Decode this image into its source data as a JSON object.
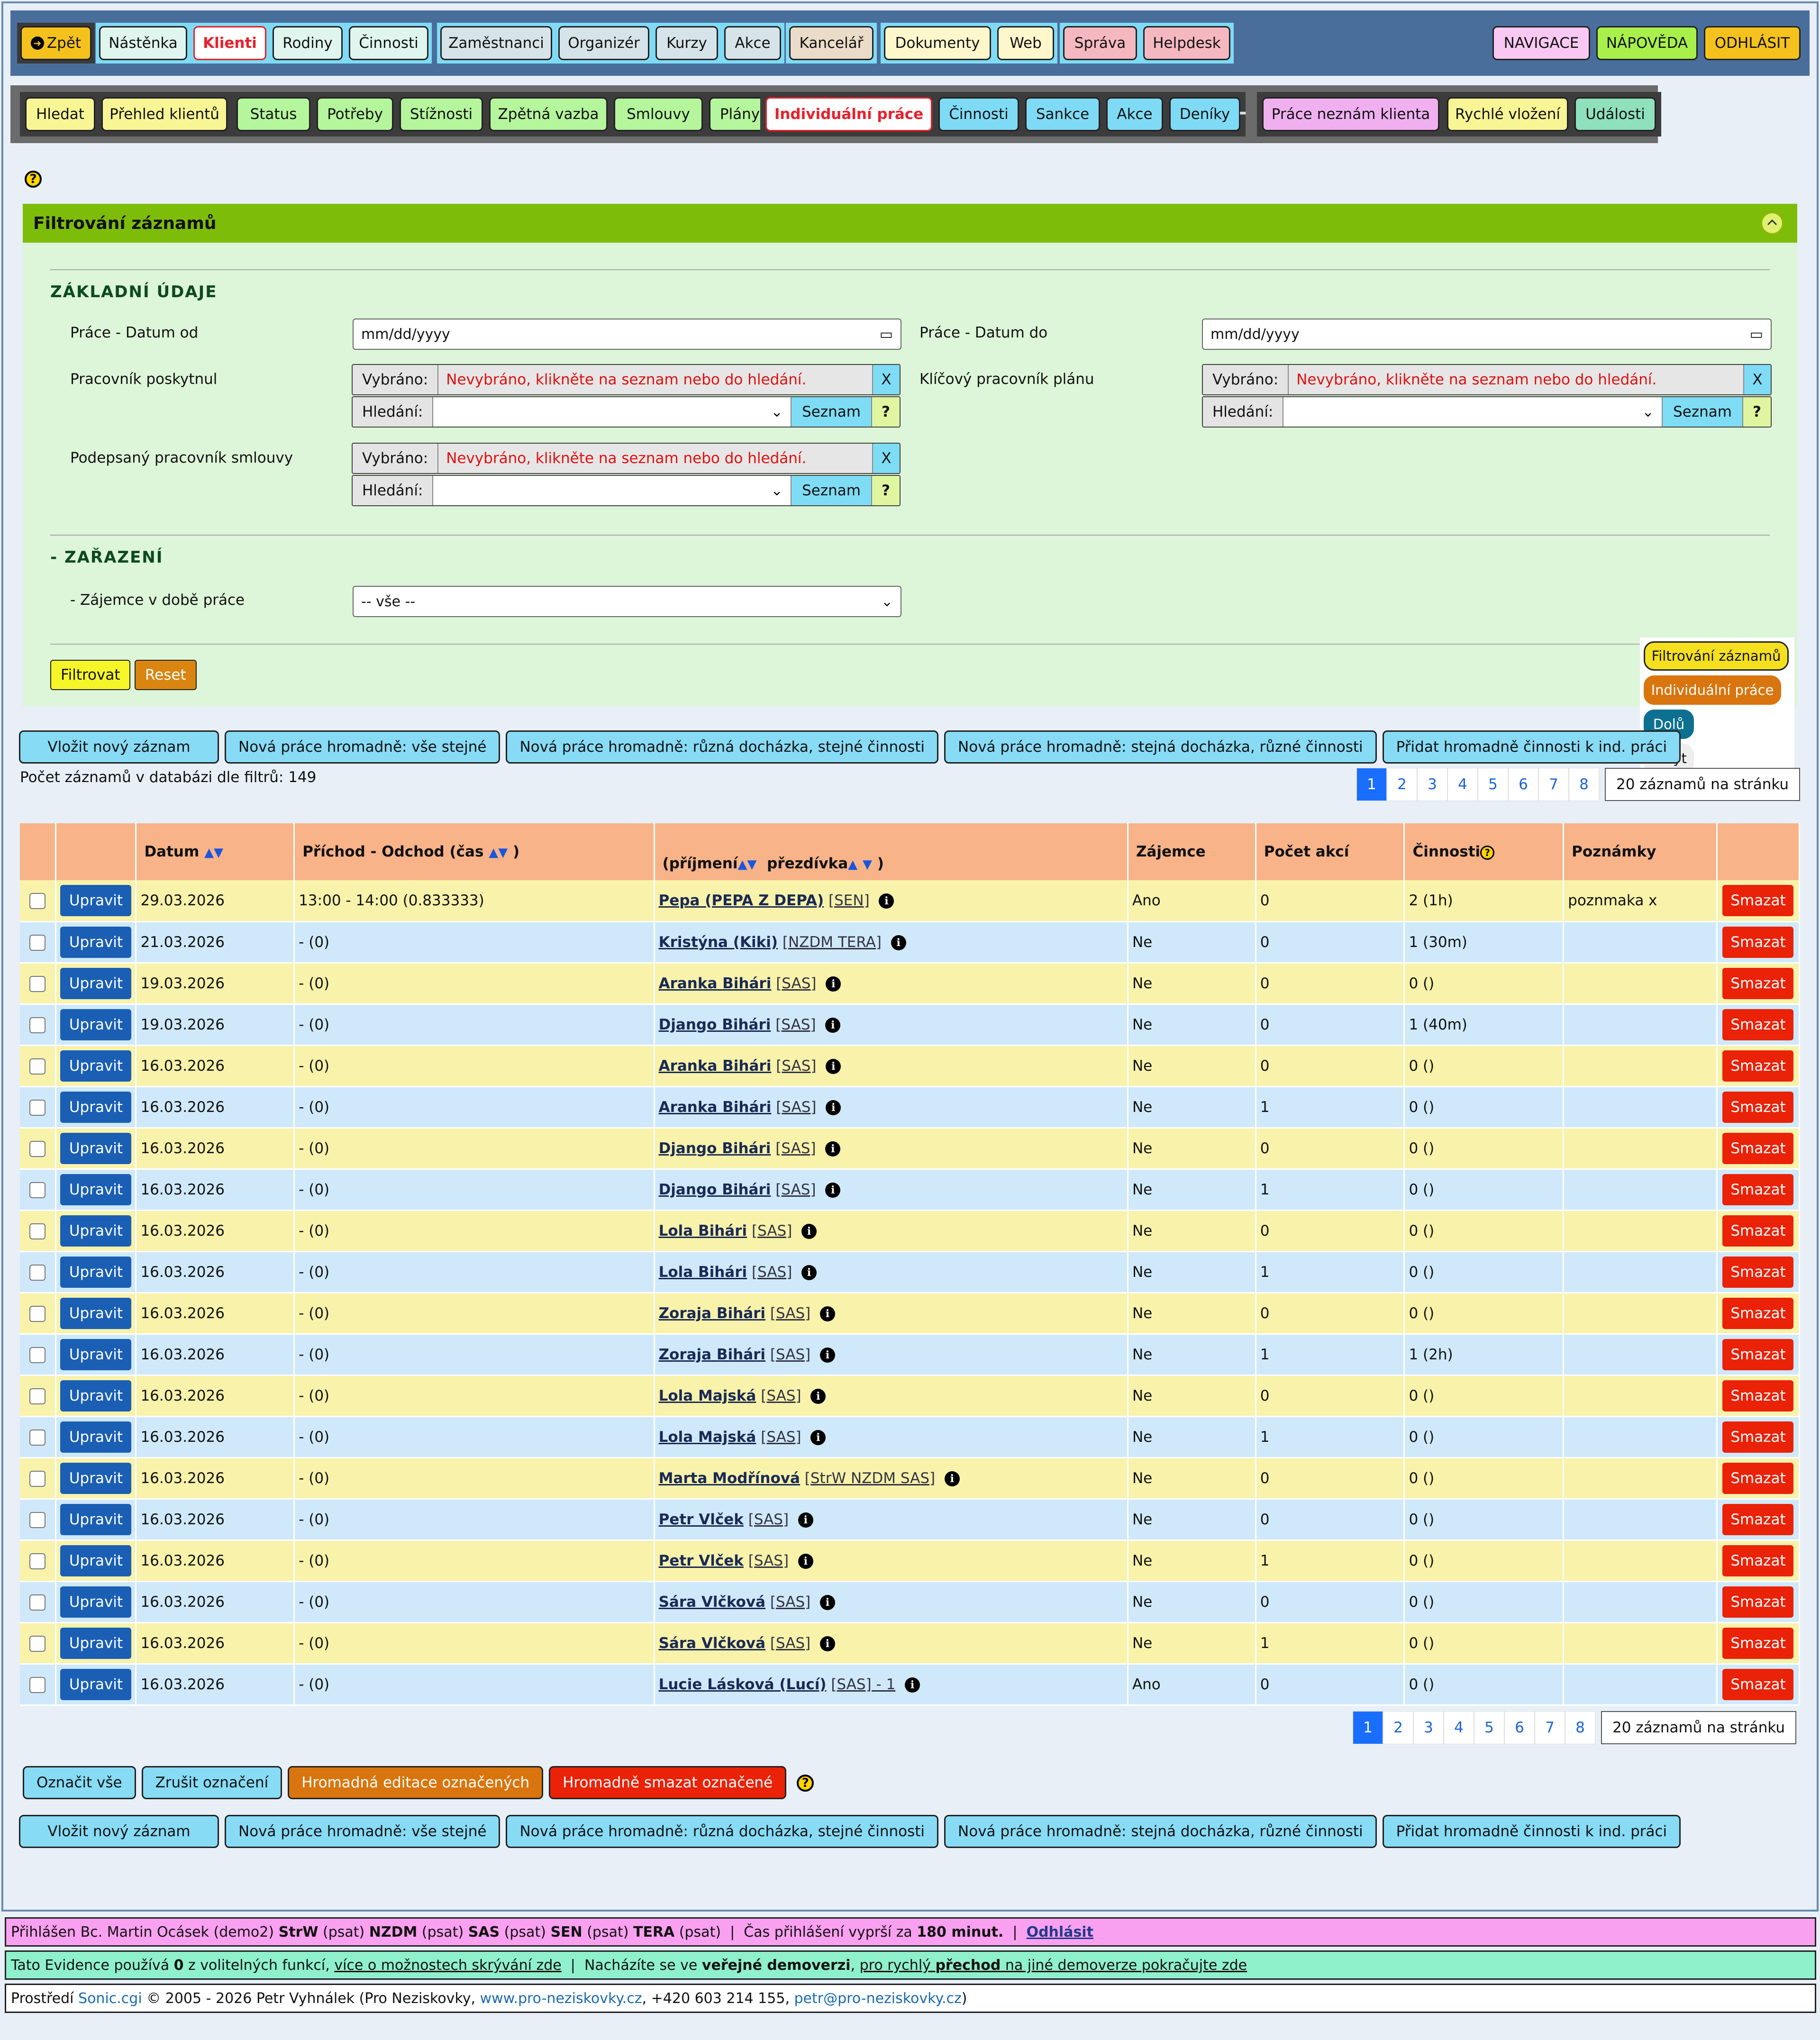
{
  "top_nav": {
    "back": "Zpět",
    "items": [
      "Nástěnka",
      "Klienti",
      "Rodiny",
      "Činnosti",
      "Zaměstnanci",
      "Organizér",
      "Kurzy",
      "Akce",
      "Kancelář",
      "Dokumenty",
      "Web",
      "Správa",
      "Helpdesk"
    ],
    "right": [
      "NAVIGACE",
      "NÁPOVĚDA",
      "ODHLÁSIT"
    ]
  },
  "sub_nav": {
    "items": [
      "Hledat",
      "Přehled klientů",
      "Status",
      "Potřeby",
      "Stížnosti",
      "Zpětná vazba",
      "Smlouvy",
      "Plány",
      "Individuální práce",
      "Činnosti",
      "Sankce",
      "Akce",
      "Deníky",
      "-",
      "Práce neznám klienta",
      "Rychlé vložení",
      "Události"
    ]
  },
  "filter": {
    "title": "Filtrování záznamů",
    "basic_section": "ZÁKLADNÍ ÚDAJE",
    "date_from_label": "Práce - Datum od",
    "date_to_label": "Práce - Datum do",
    "date_placeholder": "mm/dd/yyyy",
    "worker_label": "Pracovník poskytnul",
    "key_worker_label": "Klíčový pracovník plánu",
    "signed_worker_label": "Podepsaný pracovník smlouvy",
    "selected_label": "Vybráno:",
    "not_selected": "Nevybráno, klikněte na seznam nebo do hledání.",
    "x": "X",
    "search_label": "Hledání:",
    "list_button": "Seznam",
    "q": "?",
    "class_section": "- ZAŘAZENÍ",
    "interest_label": "- Zájemce v době práce",
    "interest_value": "-- vše --",
    "filter_button": "Filtrovat",
    "reset_button": "Reset"
  },
  "float_menu": [
    "Filtrování záznamů",
    "Individuální práce",
    "Dolů",
    "Skrýt"
  ],
  "actions": [
    "Vložit nový záznam",
    "Nová práce hromadně: vše stejné",
    "Nová práce hromadně: různá docházka, stejné činnosti",
    "Nová práce hromadně: stejná docházka, různé činnosti",
    "Přidat hromadně činnosti k ind. práci"
  ],
  "record_count": "Počet záznamů v databázi dle filtrů: 149",
  "pager": {
    "pages": [
      "1",
      "2",
      "3",
      "4",
      "5",
      "6",
      "7",
      "8"
    ],
    "per_page": "20 záznamů na stránku"
  },
  "table": {
    "headers": {
      "datum": "Datum",
      "prichod": "Příchod - Odchod (čas",
      "prichod_end": ")",
      "prijmeni": "(příjmení",
      "prezdivka": "přezdívka",
      "name_end": ")",
      "zajemce": "Zájemce",
      "pocet": "Počet akcí",
      "cinnosti": "Činnosti",
      "poznamky": "Poznámky"
    },
    "edit": "Upravit",
    "delete": "Smazat",
    "rows": [
      {
        "date": "29.03.2026",
        "time": "13:00 - 14:00 (0.833333)",
        "name": "Pepa (PEPA Z DEPA)",
        "sfx": "[SEN]",
        "zaj": "Ano",
        "pocet": "0",
        "cin": "2 (1h)",
        "pozn": "poznmaka x"
      },
      {
        "date": "21.03.2026",
        "time": "- (0)",
        "name": "Kristýna (Kiki)",
        "sfx": "[NZDM TERA]",
        "zaj": "Ne",
        "pocet": "0",
        "cin": "1 (30m)",
        "pozn": ""
      },
      {
        "date": "19.03.2026",
        "time": "- (0)",
        "name": "Aranka Bihári",
        "sfx": "[SAS]",
        "zaj": "Ne",
        "pocet": "0",
        "cin": "0 ()",
        "pozn": ""
      },
      {
        "date": "19.03.2026",
        "time": "- (0)",
        "name": "Django Bihári",
        "sfx": "[SAS]",
        "zaj": "Ne",
        "pocet": "0",
        "cin": "1 (40m)",
        "pozn": ""
      },
      {
        "date": "16.03.2026",
        "time": "- (0)",
        "name": "Aranka Bihári",
        "sfx": "[SAS]",
        "zaj": "Ne",
        "pocet": "0",
        "cin": "0 ()",
        "pozn": ""
      },
      {
        "date": "16.03.2026",
        "time": "- (0)",
        "name": "Aranka Bihári",
        "sfx": "[SAS]",
        "zaj": "Ne",
        "pocet": "1",
        "cin": "0 ()",
        "pozn": ""
      },
      {
        "date": "16.03.2026",
        "time": "- (0)",
        "name": "Django Bihári",
        "sfx": "[SAS]",
        "zaj": "Ne",
        "pocet": "0",
        "cin": "0 ()",
        "pozn": ""
      },
      {
        "date": "16.03.2026",
        "time": "- (0)",
        "name": "Django Bihári",
        "sfx": "[SAS]",
        "zaj": "Ne",
        "pocet": "1",
        "cin": "0 ()",
        "pozn": ""
      },
      {
        "date": "16.03.2026",
        "time": "- (0)",
        "name": "Lola Bihári",
        "sfx": "[SAS]",
        "zaj": "Ne",
        "pocet": "0",
        "cin": "0 ()",
        "pozn": ""
      },
      {
        "date": "16.03.2026",
        "time": "- (0)",
        "name": "Lola Bihári",
        "sfx": "[SAS]",
        "zaj": "Ne",
        "pocet": "1",
        "cin": "0 ()",
        "pozn": ""
      },
      {
        "date": "16.03.2026",
        "time": "- (0)",
        "name": "Zoraja Bihári",
        "sfx": "[SAS]",
        "zaj": "Ne",
        "pocet": "0",
        "cin": "0 ()",
        "pozn": ""
      },
      {
        "date": "16.03.2026",
        "time": "- (0)",
        "name": "Zoraja Bihári",
        "sfx": "[SAS]",
        "zaj": "Ne",
        "pocet": "1",
        "cin": "1 (2h)",
        "pozn": ""
      },
      {
        "date": "16.03.2026",
        "time": "- (0)",
        "name": "Lola Majská",
        "sfx": "[SAS]",
        "zaj": "Ne",
        "pocet": "0",
        "cin": "0 ()",
        "pozn": ""
      },
      {
        "date": "16.03.2026",
        "time": "- (0)",
        "name": "Lola Majská",
        "sfx": "[SAS]",
        "zaj": "Ne",
        "pocet": "1",
        "cin": "0 ()",
        "pozn": ""
      },
      {
        "date": "16.03.2026",
        "time": "- (0)",
        "name": "Marta Modřínová",
        "sfx": "[StrW NZDM SAS]",
        "zaj": "Ne",
        "pocet": "0",
        "cin": "0 ()",
        "pozn": ""
      },
      {
        "date": "16.03.2026",
        "time": "- (0)",
        "name": "Petr Vlček",
        "sfx": "[SAS]",
        "zaj": "Ne",
        "pocet": "0",
        "cin": "0 ()",
        "pozn": ""
      },
      {
        "date": "16.03.2026",
        "time": "- (0)",
        "name": "Petr Vlček",
        "sfx": "[SAS]",
        "zaj": "Ne",
        "pocet": "1",
        "cin": "0 ()",
        "pozn": ""
      },
      {
        "date": "16.03.2026",
        "time": "- (0)",
        "name": "Sára Vlčková",
        "sfx": "[SAS]",
        "zaj": "Ne",
        "pocet": "0",
        "cin": "0 ()",
        "pozn": ""
      },
      {
        "date": "16.03.2026",
        "time": "- (0)",
        "name": "Sára Vlčková",
        "sfx": "[SAS]",
        "zaj": "Ne",
        "pocet": "1",
        "cin": "0 ()",
        "pozn": ""
      },
      {
        "date": "16.03.2026",
        "time": "- (0)",
        "name": "Lucie Lásková (Lucí)",
        "sfx": "[SAS] - 1",
        "zaj": "Ano",
        "pocet": "0",
        "cin": "0 ()",
        "pozn": ""
      }
    ]
  },
  "bulk": [
    "Označit vše",
    "Zrušit označení",
    "Hromadná editace označených",
    "Hromadně smazat označené"
  ],
  "footer": {
    "login": {
      "prefix": "Přihlášen Bc. Martin Ocásek (demo2) ",
      "roles": [
        [
          "StrW",
          " (psat) "
        ],
        [
          "NZDM",
          " (psat) "
        ],
        [
          "SAS",
          " (psat) "
        ],
        [
          "SEN",
          " (psat) "
        ],
        [
          "TERA",
          " (psat)"
        ]
      ],
      "sep": "  |  Čas přihlášení vyprší za ",
      "minutes": "180 minut.",
      "sep2": "  |  ",
      "logout": "Odhlásit"
    },
    "info": {
      "a": "Tato Evidence používá ",
      "n": "0",
      "b": " z volitelných funkcí, ",
      "link1": "více o možnostech skrývání zde",
      "c": "  |  Nacházíte se ve ",
      "demo": "veřejné demoverzi",
      "d": ", ",
      "link2a": "pro rychlý ",
      "link2b": "přechod",
      "link2c": " na jiné demoverze pokračujte zde"
    },
    "copy": {
      "a": "Prostředí ",
      "sonic": "Sonic.cgi",
      "b": " © 2005 - 2026 Petr Vyhnálek (Pro Neziskovky, ",
      "web": "www.pro-neziskovky.cz",
      "c": ", +420 603 214 155, ",
      "mail": "petr@pro-neziskovky.cz",
      "d": ")"
    }
  },
  "colors": {
    "active_tab": "#e8202a",
    "panel_head": "#7dbd0a",
    "delete": "#ea2208",
    "edit": "#1a5fb4"
  }
}
